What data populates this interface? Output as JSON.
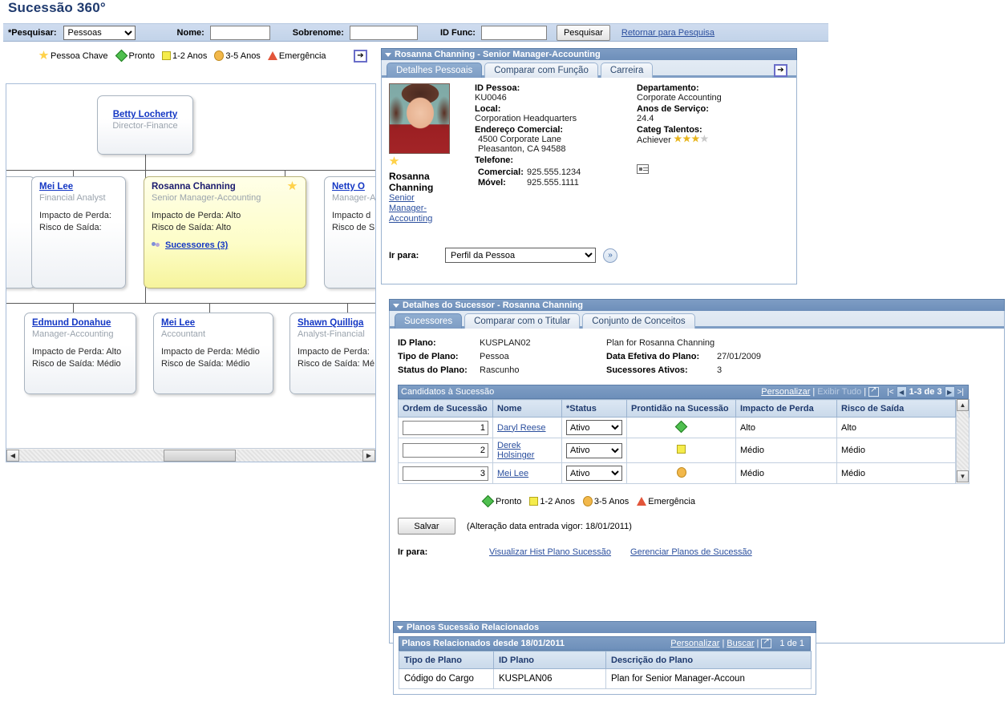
{
  "page": {
    "title": "Sucessão 360°"
  },
  "search": {
    "label": "*Pesquisar:",
    "type_value": "Pessoas",
    "type_options": [
      "Pessoas"
    ],
    "name_label": "Nome:",
    "name_value": "",
    "surname_label": "Sobrenome:",
    "surname_value": "",
    "empid_label": "ID Func:",
    "empid_value": "",
    "search_button": "Pesquisar",
    "return_link": "Retornar para Pesquisa"
  },
  "legend_top": [
    {
      "icon": "key-person-star-icon",
      "label": "Pessoa Chave"
    },
    {
      "icon": "ready-diamond-icon",
      "label": "Pronto"
    },
    {
      "icon": "one-two-years-square-icon",
      "label": "1-2 Anos"
    },
    {
      "icon": "three-five-years-circle-icon",
      "label": "3-5 Anos"
    },
    {
      "icon": "emergency-triangle-icon",
      "label": "Emergência"
    }
  ],
  "orgchart": {
    "root": {
      "name": "Betty Locherty",
      "title": "Director-Finance"
    },
    "level2": [
      {
        "name": "Mei Lee",
        "title": "Financial Analyst",
        "loss_label": "Impacto de Perda:",
        "loss_value": "",
        "risk_label": "Risco de Saída:",
        "risk_value": "",
        "highlight": false,
        "key_person": false,
        "successors": ""
      },
      {
        "name": "Rosanna Channing",
        "title": "Senior Manager-Accounting",
        "loss_label": "Impacto de Perda:",
        "loss_value": "Alto",
        "risk_label": "Risco de Saída:",
        "risk_value": "Alto",
        "highlight": true,
        "key_person": true,
        "successors": "Sucessores (3)"
      },
      {
        "name": "Netty O",
        "title": "Manager-A",
        "loss_label": "Impacto d",
        "loss_value": "",
        "risk_label": "Risco de S",
        "risk_value": "",
        "highlight": false,
        "key_person": false,
        "successors": ""
      }
    ],
    "level3": [
      {
        "name": "Edmund Donahue",
        "title": "Manager-Accounting",
        "loss_label": "Impacto de Perda:",
        "loss_value": "Alto",
        "risk_label": "Risco de Saída:",
        "risk_value": "Médio"
      },
      {
        "name": "Mei Lee",
        "title": "Accountant",
        "loss_label": "Impacto de Perda:",
        "loss_value": "Médio",
        "risk_label": "Risco de Saída:",
        "risk_value": "Médio"
      },
      {
        "name": "Shawn Quilliga",
        "title": "Analyst-Financial",
        "loss_label": "Impacto de Perda:",
        "loss_value": "",
        "risk_label": "Risco de Saída: Mé",
        "risk_value": ""
      }
    ]
  },
  "person_panel": {
    "header": "Rosanna Channing - Senior Manager-Accounting",
    "tabs": [
      {
        "label": "Detalhes Pessoais",
        "active": true
      },
      {
        "label": "Comparar com Função",
        "active": false
      },
      {
        "label": "Carreira",
        "active": false
      }
    ],
    "photo_name": "Rosanna Channing",
    "photo_role": "Senior Manager-Accounting",
    "fields_left": [
      {
        "label": "ID Pessoa:",
        "value": "KU0046"
      },
      {
        "label": "Local:",
        "value": "Corporation Headquarters"
      },
      {
        "label": "Endereço Comercial:",
        "value": "4500 Corporate Lane"
      },
      {
        "label": "",
        "value": "Pleasanton, CA 94588"
      },
      {
        "label": "Telefone:",
        "value": ""
      }
    ],
    "phones": [
      {
        "label": "Comercial:",
        "value": "925.555.1234"
      },
      {
        "label": "Móvel:",
        "value": "925.555.1111"
      }
    ],
    "fields_right": [
      {
        "label": "Departamento:",
        "value": "Corporate Accounting"
      },
      {
        "label": "Anos de Serviço:",
        "value": "24.4"
      },
      {
        "label": "Categ Talentos:",
        "value": "Achiever"
      }
    ],
    "talent_stars_filled": 3,
    "talent_stars_total": 4,
    "goto_label": "Ir para:",
    "goto_value": "Perfil da Pessoa",
    "goto_options": [
      "Perfil da Pessoa"
    ],
    "go_button": "»"
  },
  "successor_panel": {
    "header": "Detalhes do Sucessor - Rosanna Channing",
    "tabs": [
      {
        "label": "Sucessores",
        "active": true
      },
      {
        "label": "Comparar com o Titular",
        "active": false
      },
      {
        "label": "Conjunto de Conceitos",
        "active": false
      }
    ],
    "plan_fields": [
      {
        "label": "ID Plano:",
        "value": "KUSPLAN02"
      },
      {
        "label": "Tipo de Plano:",
        "value": "Pessoa"
      },
      {
        "label": "Status do Plano:",
        "value": "Rascunho"
      }
    ],
    "plan_fields_right": [
      {
        "label": "",
        "value": "Plan for Rosanna Channing"
      },
      {
        "label": "Data Efetiva do Plano:",
        "value": "27/01/2009"
      },
      {
        "label": "Sucessores Ativos:",
        "value": "3"
      }
    ],
    "grid": {
      "title": "Candidatos à Sucessão",
      "customize_link": "Personalizar",
      "viewall_link": "Exibir Tudo",
      "pager": "1-3 de 3",
      "columns": [
        "Ordem de Sucessão",
        "Nome",
        "*Status",
        "Prontidão na Sucessão",
        "Impacto de Perda",
        "Risco de Saída"
      ],
      "rows": [
        {
          "order": "1",
          "name": "Daryl Reese",
          "status": "Ativo",
          "readiness_icon": "ready-diamond-icon",
          "loss_impact": "Alto",
          "exit_risk": "Alto"
        },
        {
          "order": "2",
          "name": "Derek Holsinger",
          "status": "Ativo",
          "readiness_icon": "one-two-years-square-icon",
          "loss_impact": "Médio",
          "exit_risk": "Médio"
        },
        {
          "order": "3",
          "name": "Mei Lee",
          "status": "Ativo",
          "readiness_icon": "three-five-years-circle-icon",
          "loss_impact": "Médio",
          "exit_risk": "Médio"
        }
      ],
      "status_options": [
        "Ativo"
      ]
    },
    "legend": [
      {
        "icon": "ready-diamond-icon",
        "label": "Pronto"
      },
      {
        "icon": "one-two-years-square-icon",
        "label": "1-2 Anos"
      },
      {
        "icon": "three-five-years-circle-icon",
        "label": "3-5 Anos"
      },
      {
        "icon": "emergency-triangle-icon",
        "label": "Emergência"
      }
    ],
    "save_button": "Salvar",
    "save_note": "(Alteração data entrada vigor: 18/01/2011)",
    "goto_label": "Ir para:",
    "goto_links": [
      "Visualizar Hist Plano Sucessão",
      "Gerenciar Planos de Sucessão"
    ]
  },
  "related_panel": {
    "header": "Planos Sucessão Relacionados",
    "grid_title": "Planos Relacionados desde 18/01/2011",
    "customize_link": "Personalizar",
    "find_link": "Buscar",
    "pager": "1 de 1",
    "columns": [
      "Tipo de Plano",
      "ID Plano",
      "Descrição do Plano"
    ],
    "rows": [
      {
        "plan_type": "Código do Cargo",
        "plan_id": "KUSPLAN06",
        "plan_desc": "Plan for Senior Manager-Accoun"
      }
    ]
  }
}
